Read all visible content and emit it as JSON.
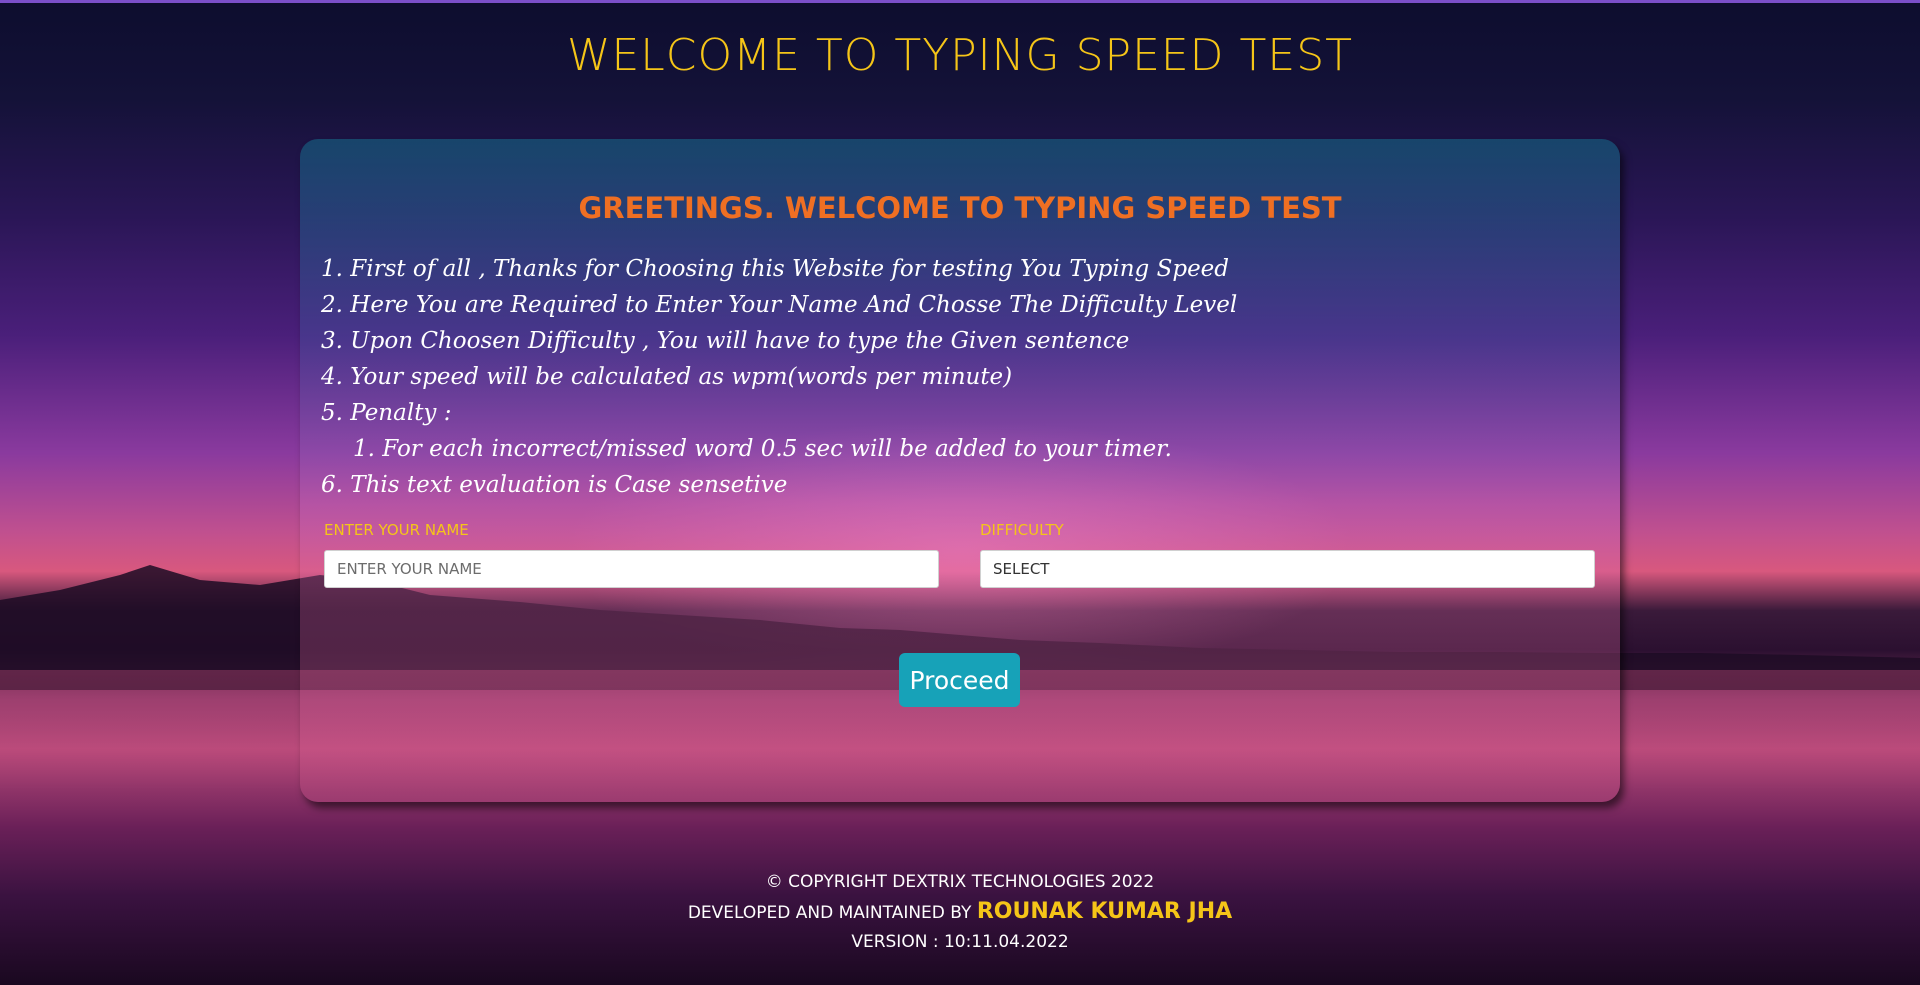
{
  "header": {
    "title": "WELCOME TO TYPING SPEED TEST"
  },
  "card": {
    "heading": "GREETINGS. WELCOME TO TYPING SPEED TEST",
    "rules": [
      "1. First of all , Thanks for Choosing this Website for testing You Typing Speed",
      "2. Here You are Required to Enter Your Name And Chosse The Difficulty Level",
      "3. Upon Choosen Difficulty , You will have to type the Given sentence",
      "4. Your speed will be calculated as wpm(words per minute)",
      "5. Penalty :",
      "1. For each incorrect/missed word 0.5 sec will be added to your timer.",
      "6. This text evaluation is Case sensetive"
    ]
  },
  "form": {
    "name_label": "ENTER YOUR NAME",
    "name_placeholder": "ENTER YOUR NAME",
    "difficulty_label": "DIFFICULTY",
    "difficulty_selected": "SELECT",
    "proceed_label": "Proceed"
  },
  "footer": {
    "copyright": "© COPYRIGHT DEXTRIX TECHNOLOGIES 2022",
    "developed_prefix": "DEVELOPED AND MAINTAINED BY",
    "developer": "ROUNAK KUMAR JHA",
    "version": "VERSION : 10:11.04.2022"
  },
  "colors": {
    "title": "#f5c518",
    "heading": "#ef6f23",
    "button": "#17a2b8"
  }
}
